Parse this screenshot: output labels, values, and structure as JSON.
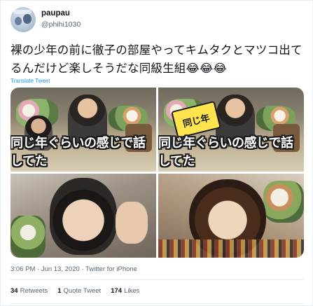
{
  "user": {
    "display_name": "paupau",
    "handle": "@phihi1030"
  },
  "tweet": {
    "text": "裸の少年の前に徹子の部屋やってキムタクとマツコ出てるんだけど楽しそうだな同級生組😂😂😂",
    "translate_label": "Translate Tweet"
  },
  "media": {
    "caption_left": "同じ年ぐらいの感じで話してた",
    "caption_right": "同じ年ぐらいの感じで話してた",
    "callout": "同じ年"
  },
  "meta": {
    "timestamp": "3:06 PM · Jun 13, 2020 · Twitter for iPhone"
  },
  "stats": {
    "retweets_count": "34",
    "retweets_label": "Retweets",
    "quotes_count": "1",
    "quotes_label": "Quote Tweet",
    "likes_count": "174",
    "likes_label": "Likes"
  },
  "colors": {
    "link": "#1d9bf0",
    "secondary_text": "#536471",
    "border": "#e6ecf0"
  }
}
